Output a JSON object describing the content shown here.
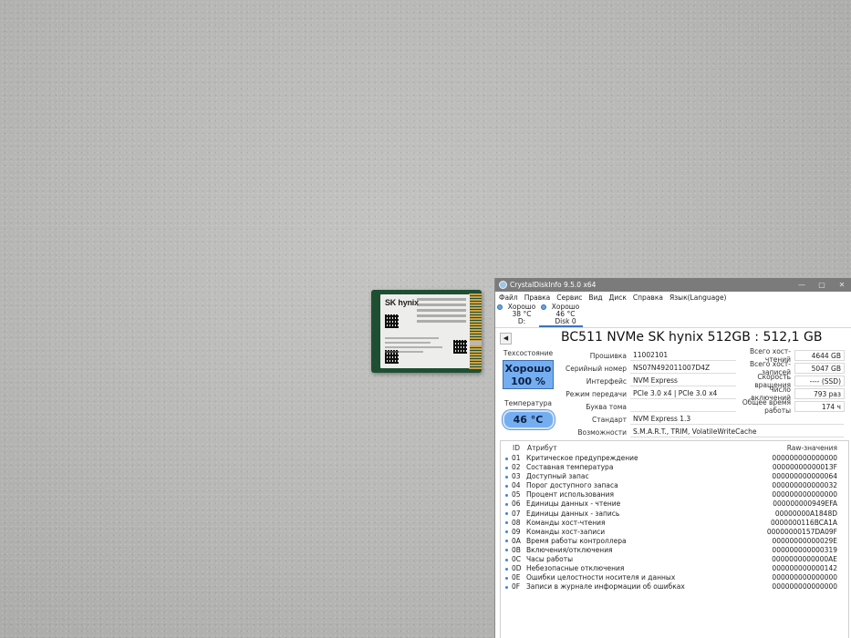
{
  "window": {
    "title": "CrystalDiskInfo 9.5.0 x64",
    "controls": [
      "—",
      "▢",
      "✕"
    ]
  },
  "menu": [
    "Файл",
    "Правка",
    "Сервис",
    "Вид",
    "Диск",
    "Справка",
    "Язык(Language)"
  ],
  "disks": [
    {
      "status": "Хорошо",
      "temp": "38 °C",
      "name": "D:"
    },
    {
      "status": "Хорошо",
      "temp": "46 °C",
      "name": "Disk 0"
    }
  ],
  "model": "BC511 NVMe SK hynix 512GB : 512,1 GB",
  "health": {
    "caption": "Техсостояние",
    "status": "Хорошо",
    "percent": "100 %"
  },
  "temperature": {
    "caption": "Температура",
    "value": "46 °C"
  },
  "info_mid": [
    {
      "label": "Прошивка",
      "value": "11002101"
    },
    {
      "label": "Серийный номер",
      "value": "NS07N492011007D4Z"
    },
    {
      "label": "Интерфейс",
      "value": "NVM Express"
    },
    {
      "label": "Режим передачи",
      "value": "PCIe 3.0 x4 | PCIe 3.0 x4"
    },
    {
      "label": "Буква тома",
      "value": ""
    }
  ],
  "info_right": [
    {
      "label": "Всего хост-чтений",
      "value": "4644 GB"
    },
    {
      "label": "Всего хост-записей",
      "value": "5047 GB"
    },
    {
      "label": "Скорость вращения",
      "value": "---- (SSD)"
    },
    {
      "label": "Число включений",
      "value": "793 раз"
    },
    {
      "label": "Общее время работы",
      "value": "174 ч"
    }
  ],
  "info_wide": [
    {
      "label": "Стандарт",
      "value": "NVM Express 1.3"
    },
    {
      "label": "Возможности",
      "value": "S.M.A.R.T., TRIM, VolatileWriteCache"
    }
  ],
  "smart": {
    "headers": {
      "id": "ID",
      "attribute": "Атрибут",
      "raw": "Raw-значения"
    },
    "rows": [
      {
        "id": "01",
        "name": "Критическое предупреждение",
        "raw": "000000000000000"
      },
      {
        "id": "02",
        "name": "Составная температура",
        "raw": "00000000000013F"
      },
      {
        "id": "03",
        "name": "Доступный запас",
        "raw": "000000000000064"
      },
      {
        "id": "04",
        "name": "Порог доступного запаса",
        "raw": "000000000000032"
      },
      {
        "id": "05",
        "name": "Процент использования",
        "raw": "000000000000000"
      },
      {
        "id": "06",
        "name": "Единицы данных - чтение",
        "raw": "000000000949EFA"
      },
      {
        "id": "07",
        "name": "Единицы данных - запись",
        "raw": "00000000A1848D"
      },
      {
        "id": "08",
        "name": "Команды хост-чтения",
        "raw": "0000000116BCA1A"
      },
      {
        "id": "09",
        "name": "Команды хост-записи",
        "raw": "00000000157DA09F"
      },
      {
        "id": "0A",
        "name": "Время работы контроллера",
        "raw": "00000000000029E"
      },
      {
        "id": "0B",
        "name": "Включения/отключения",
        "raw": "000000000000319"
      },
      {
        "id": "0C",
        "name": "Часы работы",
        "raw": "0000000000000AE"
      },
      {
        "id": "0D",
        "name": "Небезопасные отключения",
        "raw": "000000000000142"
      },
      {
        "id": "0E",
        "name": "Ошибки целостности носителя и данных",
        "raw": "000000000000000"
      },
      {
        "id": "0F",
        "name": "Записи в журнале информации об ошибках",
        "raw": "000000000000000"
      }
    ]
  },
  "ssd_photo": {
    "brand": "SK hynix"
  }
}
